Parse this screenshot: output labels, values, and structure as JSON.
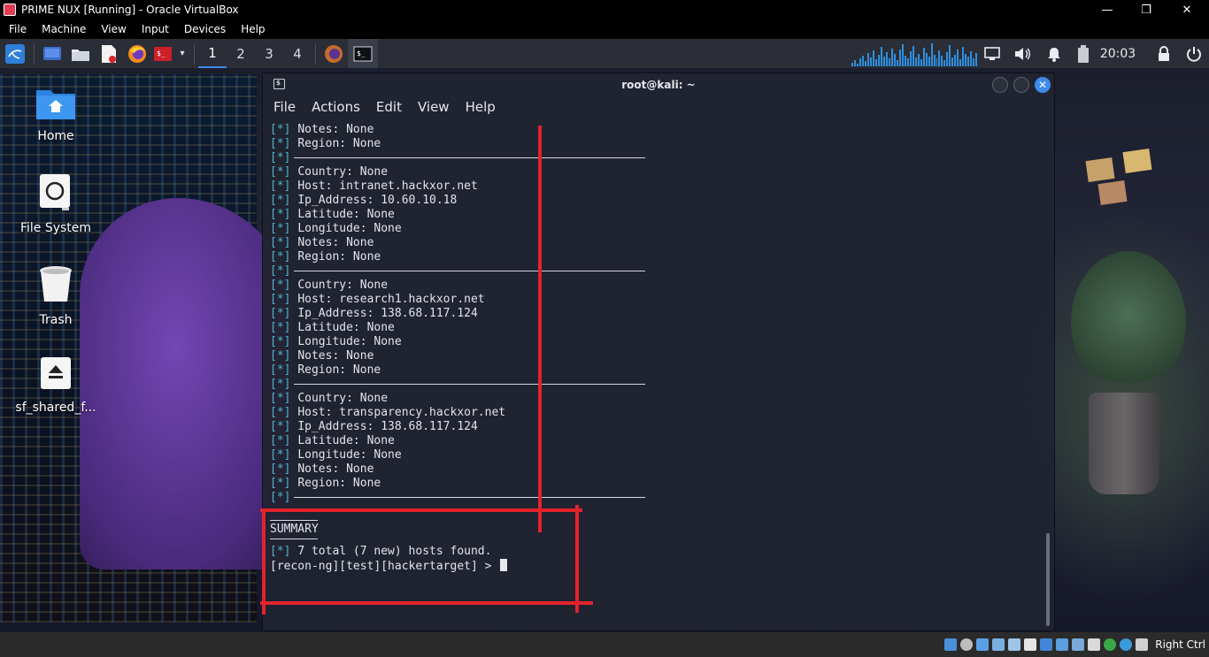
{
  "vbox": {
    "title": "PRIME NUX [Running] - Oracle VirtualBox",
    "window_controls": {
      "minimize": "—",
      "restore": "❐",
      "close": "✕"
    },
    "menu": [
      "File",
      "Machine",
      "View",
      "Input",
      "Devices",
      "Help"
    ],
    "host_key": "Right Ctrl"
  },
  "panel": {
    "workspaces": [
      "1",
      "2",
      "3",
      "4"
    ],
    "active_workspace": "1",
    "clock": "20:03",
    "icons": [
      "kali-menu-icon",
      "show-desktop-icon",
      "file-manager-icon",
      "text-editor-icon",
      "firefox-icon",
      "terminal-icon",
      "dropdown-chevron-icon",
      "firefox-icon",
      "terminal-icon",
      "network-icon",
      "volume-icon",
      "notifications-icon",
      "battery-icon",
      "lock-icon",
      "power-icon"
    ]
  },
  "desktop_icons": [
    {
      "label": "Home",
      "icon": "home-folder-icon"
    },
    {
      "label": "File System",
      "icon": "filesystem-icon"
    },
    {
      "label": "Trash",
      "icon": "trash-icon"
    },
    {
      "label": "sf_shared_f...",
      "icon": "eject-drive-icon"
    }
  ],
  "terminal": {
    "title": "root@kali: ~",
    "menu": [
      "File",
      "Actions",
      "Edit",
      "View",
      "Help"
    ],
    "lines": [
      {
        "text": "Notes: None"
      },
      {
        "text": "Region: None"
      },
      {
        "rule": true
      },
      {
        "text": "Country: None"
      },
      {
        "text": "Host: intranet.hackxor.net"
      },
      {
        "text": "Ip_Address: 10.60.10.18"
      },
      {
        "text": "Latitude: None"
      },
      {
        "text": "Longitude: None"
      },
      {
        "text": "Notes: None"
      },
      {
        "text": "Region: None"
      },
      {
        "rule": true
      },
      {
        "text": "Country: None"
      },
      {
        "text": "Host: research1.hackxor.net"
      },
      {
        "text": "Ip_Address: 138.68.117.124"
      },
      {
        "text": "Latitude: None"
      },
      {
        "text": "Longitude: None"
      },
      {
        "text": "Notes: None"
      },
      {
        "text": "Region: None"
      },
      {
        "rule": true
      },
      {
        "text": "Country: None"
      },
      {
        "text": "Host: transparency.hackxor.net"
      },
      {
        "text": "Ip_Address: 138.68.117.124"
      },
      {
        "text": "Latitude: None"
      },
      {
        "text": "Longitude: None"
      },
      {
        "text": "Notes: None"
      },
      {
        "text": "Region: None"
      },
      {
        "rule": true
      }
    ],
    "bullet": "[*]",
    "summary_heading": "SUMMARY",
    "summary_line": "7 total (7 new) hosts found.",
    "prompt": "[recon-ng][test][hackertarget] > "
  },
  "colors": {
    "annotation_red": "#e3232c",
    "bullet_cyan": "#4fb5c9",
    "panel_bg": "#2b2e37",
    "accent_blue": "#3f8be8"
  }
}
